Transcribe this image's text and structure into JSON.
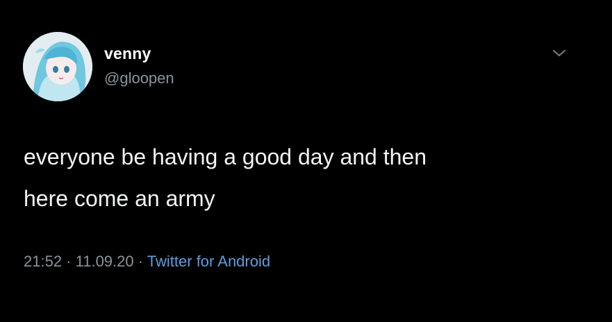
{
  "tweet": {
    "author": {
      "display_name": "venny",
      "handle": "@gloopen",
      "avatar_icon": "anime-avatar"
    },
    "menu_icon": "chevron-down-icon",
    "text_lines": [
      "everyone be having a good day and then",
      "here come an army"
    ],
    "meta": {
      "time": "21:52",
      "separator_1": " · ",
      "date": "11.09.20",
      "separator_2": " · ",
      "source": "Twitter for Android"
    }
  },
  "colors": {
    "background": "#000000",
    "text": "#f2f4f5",
    "secondary_text": "#8b949c",
    "link": "#5a9fe0"
  }
}
